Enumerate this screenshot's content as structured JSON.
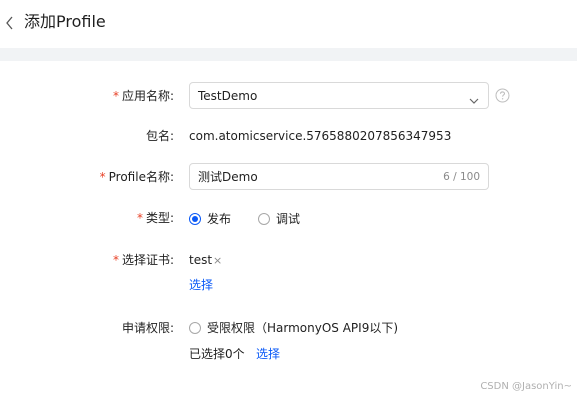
{
  "header": {
    "title": "添加Profile"
  },
  "form": {
    "app_name": {
      "label": "应用名称:",
      "required_mark": "*",
      "value": "TestDemo"
    },
    "package": {
      "label": "包名:",
      "value": "com.atomicservice.5765880207856347953"
    },
    "profile_name": {
      "label": "Profile名称:",
      "required_mark": "*",
      "value": "测试Demo",
      "counter": "6 / 100"
    },
    "type": {
      "label": "类型:",
      "required_mark": "*",
      "options": [
        {
          "label": "发布",
          "checked": true
        },
        {
          "label": "调试",
          "checked": false
        }
      ]
    },
    "certificate": {
      "label": "选择证书:",
      "required_mark": "*",
      "tag": "test",
      "tag_close": "×",
      "select_link": "选择"
    },
    "permission": {
      "label": "申请权限:",
      "option_label": "受限权限（HarmonyOS API9以下)",
      "selected_count": "已选择0个",
      "select_link": "选择"
    }
  },
  "watermark": "CSDN @JasonYin~",
  "colors": {
    "accent": "#0a59f7",
    "required": "#e84026",
    "band": "#f1f3f5"
  },
  "icons": {
    "back": "chevron-left-icon",
    "dropdown": "chevron-down-icon",
    "help": "question-circle-icon"
  }
}
